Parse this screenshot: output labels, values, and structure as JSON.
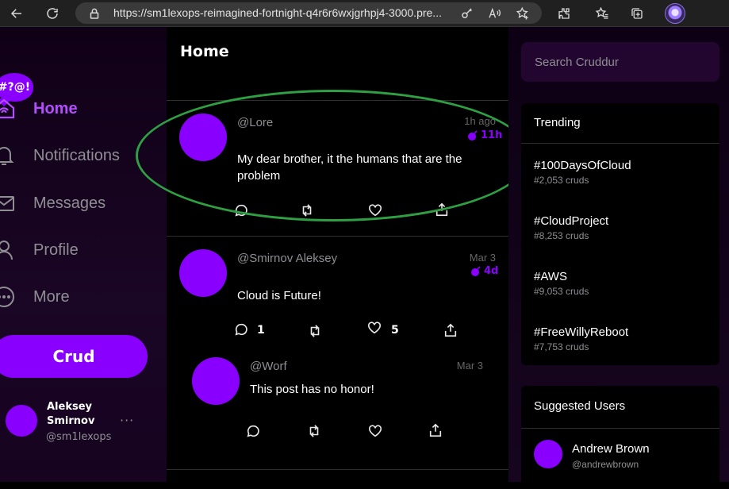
{
  "browser": {
    "url": "https://sm1lexops-reimagined-fortnight-q4r6r6wxjgrhpj4-3000.pre..."
  },
  "logo_text": "#?@!",
  "nav": {
    "home": "Home",
    "notifications": "Notifications",
    "messages": "Messages",
    "profile": "Profile",
    "more": "More"
  },
  "crud_button": "Crud",
  "account": {
    "name": "Aleksey Smirnov",
    "handle": "@sm1lexops",
    "menu": "···"
  },
  "feed": {
    "title": "Home",
    "posts": [
      {
        "handle": "@Lore",
        "time": "1h ago",
        "expires": "11h",
        "text": "My dear brother, it the humans that are the problem",
        "replies": "",
        "likes": ""
      },
      {
        "handle": "@Smirnov Aleksey",
        "time": "Mar 3",
        "expires": "4d",
        "text": "Cloud is Future!",
        "replies": "1",
        "likes": "5"
      },
      {
        "handle": "@Worf",
        "time": "Mar 3",
        "text": "This post has no honor!"
      }
    ]
  },
  "search": {
    "placeholder": "Search Cruddur"
  },
  "trending": {
    "title": "Trending",
    "items": [
      {
        "tag": "#100DaysOfCloud",
        "count": "#2,053 cruds"
      },
      {
        "tag": "#CloudProject",
        "count": "#8,253 cruds"
      },
      {
        "tag": "#AWS",
        "count": "#9,053 cruds"
      },
      {
        "tag": "#FreeWillyReboot",
        "count": "#7,753 cruds"
      }
    ]
  },
  "suggested": {
    "title": "Suggested Users",
    "users": [
      {
        "name": "Andrew Brown",
        "handle": "@andrewbrown"
      }
    ]
  },
  "colors": {
    "accent": "#8a00ff",
    "highlight_ring": "#2ea043"
  }
}
